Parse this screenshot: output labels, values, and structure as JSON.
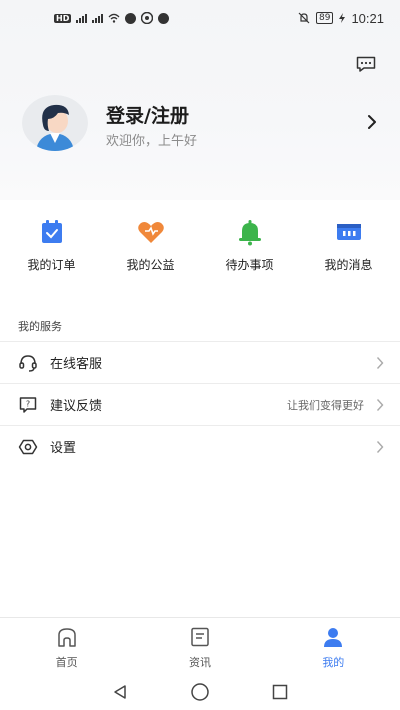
{
  "status_bar": {
    "hd": "HD",
    "sig1": "⁴G",
    "sig2": "⁴G",
    "battery": "89",
    "time": "10:21"
  },
  "profile": {
    "title": "登录/注册",
    "greeting": "欢迎你，上午好"
  },
  "quick_actions": [
    {
      "label": "我的订单",
      "icon": "order-icon",
      "color": "#3d7cf0"
    },
    {
      "label": "我的公益",
      "icon": "heart-icon",
      "color": "#f0883a"
    },
    {
      "label": "待办事项",
      "icon": "bell-icon",
      "color": "#3cb44b"
    },
    {
      "label": "我的消息",
      "icon": "message-icon",
      "color": "#3d7cf0"
    }
  ],
  "services": {
    "title": "我的服务",
    "items": [
      {
        "label": "在线客服",
        "icon": "headset-icon",
        "hint": ""
      },
      {
        "label": "建议反馈",
        "icon": "feedback-icon",
        "hint": "让我们变得更好"
      },
      {
        "label": "设置",
        "icon": "settings-icon",
        "hint": ""
      }
    ]
  },
  "bottom_nav": [
    {
      "label": "首页",
      "icon": "home-icon",
      "active": false
    },
    {
      "label": "资讯",
      "icon": "news-icon",
      "active": false
    },
    {
      "label": "我的",
      "icon": "user-icon",
      "active": true
    }
  ],
  "colors": {
    "accent": "#3d7cf0",
    "orange": "#f0883a",
    "green": "#3cb44b"
  }
}
